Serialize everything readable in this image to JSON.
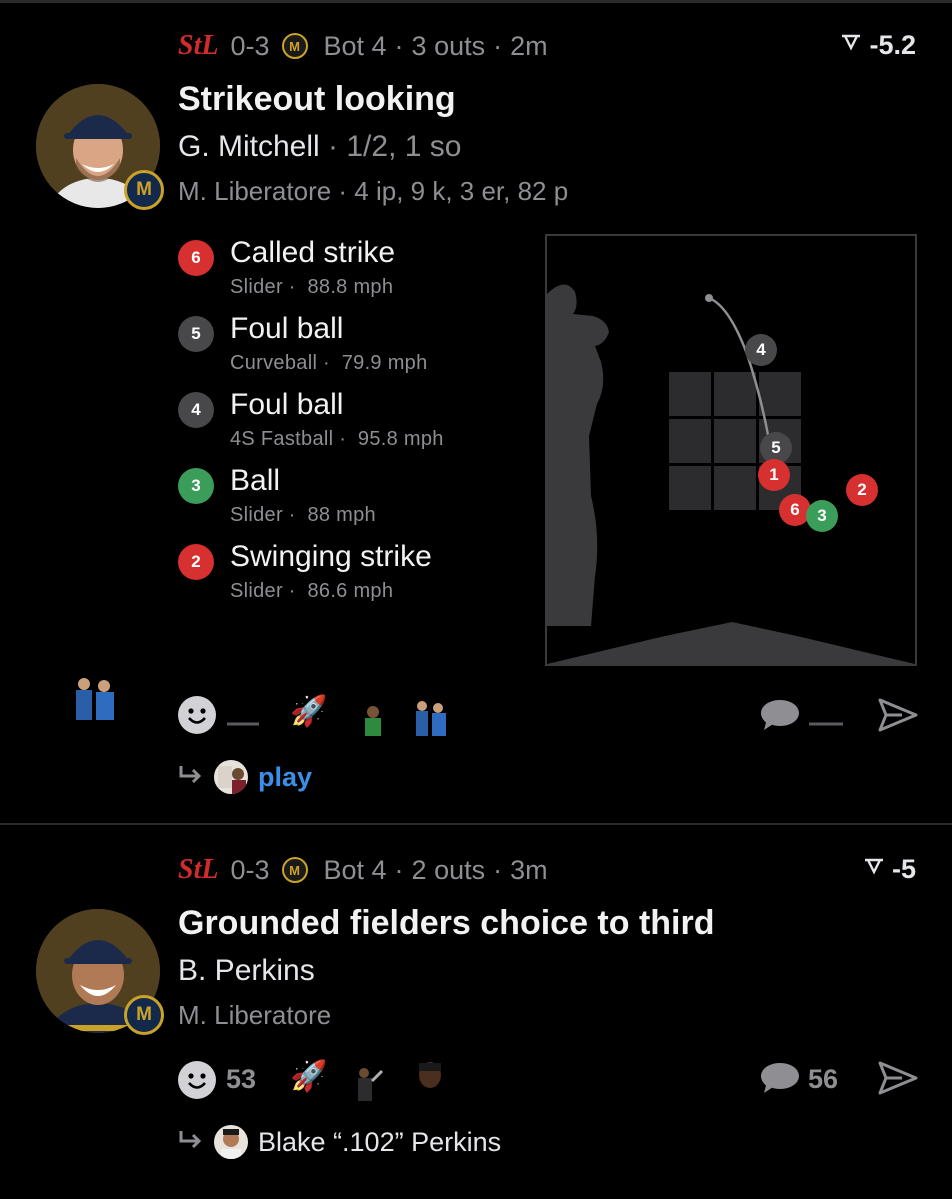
{
  "posts": [
    {
      "away_logo": "STL",
      "score": "0-3",
      "home_logo": "MIL",
      "inning": "Bot 4",
      "outs": "3 outs",
      "time": "2m",
      "win_prob": "-5.2",
      "headline": "Strikeout looking",
      "batter_name": "G. Mitchell",
      "batter_stats": "1/2, 1 so",
      "pitcher_line": "M. Liberatore · 4 ip, 9 k, 3 er, 82 p",
      "pitches": [
        {
          "num": "6",
          "result": "Called strike",
          "type": "Slider",
          "speed": "88.8 mph",
          "color": "#d63031"
        },
        {
          "num": "5",
          "result": "Foul ball",
          "type": "Curveball",
          "speed": "79.9 mph",
          "color": "#48484a"
        },
        {
          "num": "4",
          "result": "Foul ball",
          "type": "4S Fastball",
          "speed": "95.8 mph",
          "color": "#48484a"
        },
        {
          "num": "3",
          "result": "Ball",
          "type": "Slider",
          "speed": "88 mph",
          "color": "#3a9d5a"
        },
        {
          "num": "2",
          "result": "Swinging strike",
          "type": "Slider",
          "speed": "86.6 mph",
          "color": "#d63031"
        }
      ],
      "zone_dots": [
        {
          "num": "4",
          "color": "#48484a"
        },
        {
          "num": "5",
          "color": "#48484a"
        },
        {
          "num": "1",
          "color": "#d63031"
        },
        {
          "num": "2",
          "color": "#d63031"
        },
        {
          "num": "6",
          "color": "#d63031"
        },
        {
          "num": "3",
          "color": "#3a9d5a"
        }
      ],
      "reply_link": "play",
      "icons": [
        "smile-icon",
        "rocket-icon",
        "comment-icon",
        "share-icon"
      ]
    },
    {
      "away_logo": "STL",
      "score": "0-3",
      "home_logo": "MIL",
      "inning": "Bot 4",
      "outs": "2 outs",
      "time": "3m",
      "win_prob": "-5",
      "headline": "Grounded fielders choice to third",
      "batter_name": "B. Perkins",
      "pitcher_line": "M. Liberatore",
      "reaction_count": "53",
      "comment_count": "56",
      "reply_title": "Blake “.102” Perkins",
      "icons": [
        "smile-icon",
        "rocket-icon",
        "comment-icon",
        "share-icon"
      ]
    }
  ]
}
